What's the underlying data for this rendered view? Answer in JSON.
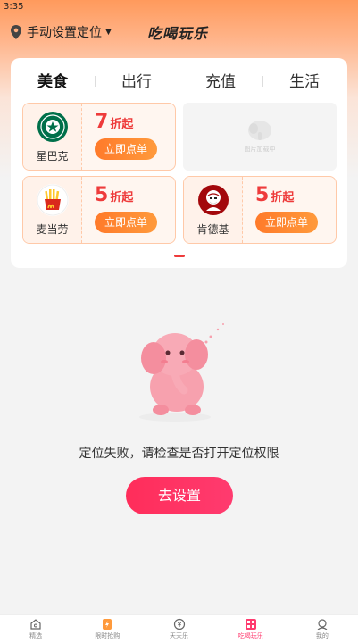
{
  "status": {
    "time": "3:35"
  },
  "header": {
    "location_text": "手动设置定位",
    "app_title": "吃喝玩乐"
  },
  "tabs": [
    {
      "label": "美食",
      "active": true
    },
    {
      "label": "出行",
      "active": false
    },
    {
      "label": "充值",
      "active": false
    },
    {
      "label": "生活",
      "active": false
    }
  ],
  "coupons": [
    {
      "brand": "星巴克",
      "discount": "7",
      "unit": "折起",
      "button": "立即点单"
    },
    {
      "brand": "麦当劳",
      "discount": "5",
      "unit": "折起",
      "button": "立即点单"
    },
    {
      "brand": "肯德基",
      "discount": "5",
      "unit": "折起",
      "button": "立即点单"
    }
  ],
  "placeholder": {
    "label": "图片加载中"
  },
  "empty_state": {
    "message": "定位失败，请检查是否打开定位权限",
    "button": "去设置"
  },
  "bottom_nav": [
    {
      "label": "精选",
      "icon": "home-icon",
      "active": false
    },
    {
      "label": "限时抢购",
      "icon": "flash-sale-icon",
      "active": false
    },
    {
      "label": "天天乐",
      "icon": "yuan-coin-icon",
      "active": false
    },
    {
      "label": "吃喝玩乐",
      "icon": "food-fun-icon",
      "active": true
    },
    {
      "label": "我的",
      "icon": "profile-icon",
      "active": false
    }
  ],
  "colors": {
    "accent": "#ff3b6f",
    "discount_red": "#ee3b3b",
    "order_orange": "#ff7a2a",
    "header_orange": "#ff9a5c"
  }
}
